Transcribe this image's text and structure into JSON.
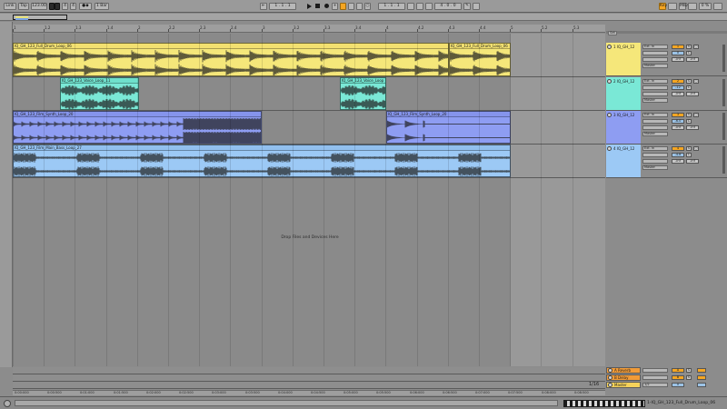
{
  "transport": {
    "link": "Link",
    "tap": "Tap",
    "tempo": "123.00",
    "sig_num": "4",
    "sig_den": "4",
    "quantize": "1 Bar",
    "position": "1 . 1 . 1",
    "loop_start": "1 . 1 . 1",
    "loop_length": "4 . 0 . 0",
    "key": "Key",
    "midi": "MIDI",
    "cpu": "0 %"
  },
  "ruler_beats": [
    "1",
    "1.2",
    "1.3",
    "1.4",
    "2",
    "2.2",
    "2.3",
    "2.4",
    "3",
    "3.2",
    "3.3",
    "3.4",
    "4",
    "4.2",
    "4.3",
    "4.4",
    "5",
    "5.2",
    "5.3"
  ],
  "clips": [
    {
      "lane": 0,
      "name": "IQ_GH_123_Full_Drum_Loop_06"
    },
    {
      "lane": 0,
      "name": "IQ_GH_123_Full_Drum_Loop_06"
    },
    {
      "lane": 1,
      "name": "IQ_GH_123_Voice_Loop_11"
    },
    {
      "lane": 1,
      "name": "IQ_GH_123_Voice_Loop"
    },
    {
      "lane": 2,
      "name": "IQ_GH_123_Film_Synth_Loop_20"
    },
    {
      "lane": 2,
      "name": "IQ_GH_123_Film_Synth_Loop_20"
    },
    {
      "lane": 3,
      "name": "IQ_GH_123_Film_Main_Bass_Loop_27"
    }
  ],
  "tracks": [
    {
      "name": "1 IQ_GH_12",
      "color": "#f5e77a",
      "input": "Ext. In",
      "output": "Master",
      "num": "1",
      "vol": "0"
    },
    {
      "name": "2 IQ_GH_12",
      "color": "#7ae8d6",
      "input": "Ext. In",
      "output": "Master",
      "num": "2",
      "vol": "-12"
    },
    {
      "name": "3 IQ_GH_12",
      "color": "#8e9df2",
      "input": "Ext. In",
      "output": "Master",
      "num": "3",
      "vol": "-6.0"
    },
    {
      "name": "4 IQ_GH_12",
      "color": "#9cc9f5",
      "input": "Ext. In",
      "output": "Master",
      "num": "4",
      "vol": "-4.8"
    }
  ],
  "set_label": "Set",
  "drop_hint": "Drop Files and Devices Here",
  "returns": [
    {
      "name": "A Reverb",
      "num": "A"
    },
    {
      "name": "B Delay",
      "num": "B"
    },
    {
      "name": "Master",
      "num": "0"
    }
  ],
  "master_sel": "1/2",
  "zoom_label": "1/16",
  "time_ruler": [
    "0:00:000",
    "0:00:500",
    "0:01:000",
    "0:01:500",
    "0:02:000",
    "0:02:500",
    "0:03:000",
    "0:03:500",
    "0:04:000",
    "0:04:500",
    "0:05:000",
    "0:05:500",
    "0:06:000",
    "0:06:500",
    "0:07:000",
    "0:07:500",
    "0:08:000",
    "0:08:500"
  ],
  "status_text": "1-IQ_GH_123_Full_Drum_Loop_06",
  "colors": {
    "drum": "#f5e77a",
    "voice": "#7ae8d6",
    "synth": "#8e9df2",
    "bass": "#9cc9f5",
    "accent": "#f5a623"
  }
}
